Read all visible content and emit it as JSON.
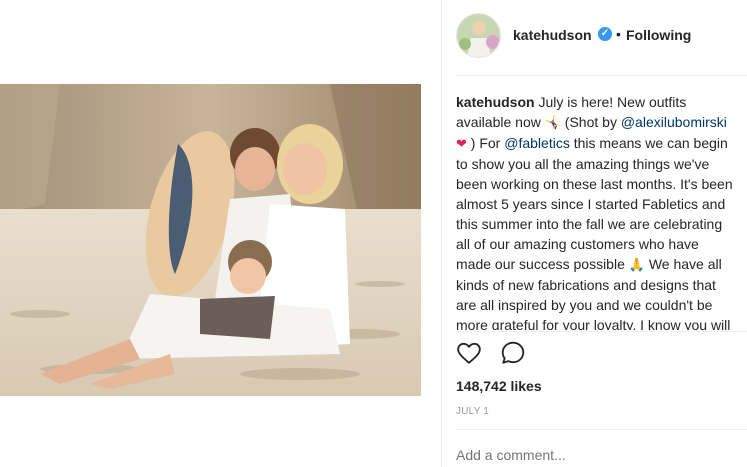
{
  "post": {
    "username": "kateh udson",
    "follow_label": "Following",
    "separator": "•",
    "caption_user": "katehudson",
    "caption_parts": [
      {
        "type": "text",
        "value": " July is here! New outfits available now "
      },
      {
        "type": "text",
        "value": " (Shot by "
      },
      {
        "type": "mention",
        "value": "@alexilubomirski"
      },
      {
        "type": "text",
        "value": " ) For "
      },
      {
        "type": "mention",
        "value": "@fabletics"
      },
      {
        "type": "text",
        "value": " this means we can begin to show you all the amazing things we've been working on these last months. It's been almost 5 years since I started Fabletics and this summer into the fall we are celebrating all of our amazing customers who have made our success possible "
      },
      {
        "type": "text",
        "value": " We have all kinds of new fabrications and designs that are all inspired by you and we couldn't be more grateful for your loyalty. I know you will"
      }
    ],
    "likes": "148,742 likes",
    "date": "JULY 1",
    "comment_placeholder": "Add a comment...",
    "verified_glyph": "✓"
  },
  "icons": {
    "like": "heart-outline-icon",
    "comment": "speech-bubble-icon",
    "verified": "verified-badge-icon"
  },
  "colors": {
    "verified": "#3897f0",
    "mention": "#003569",
    "muted": "#999999"
  }
}
